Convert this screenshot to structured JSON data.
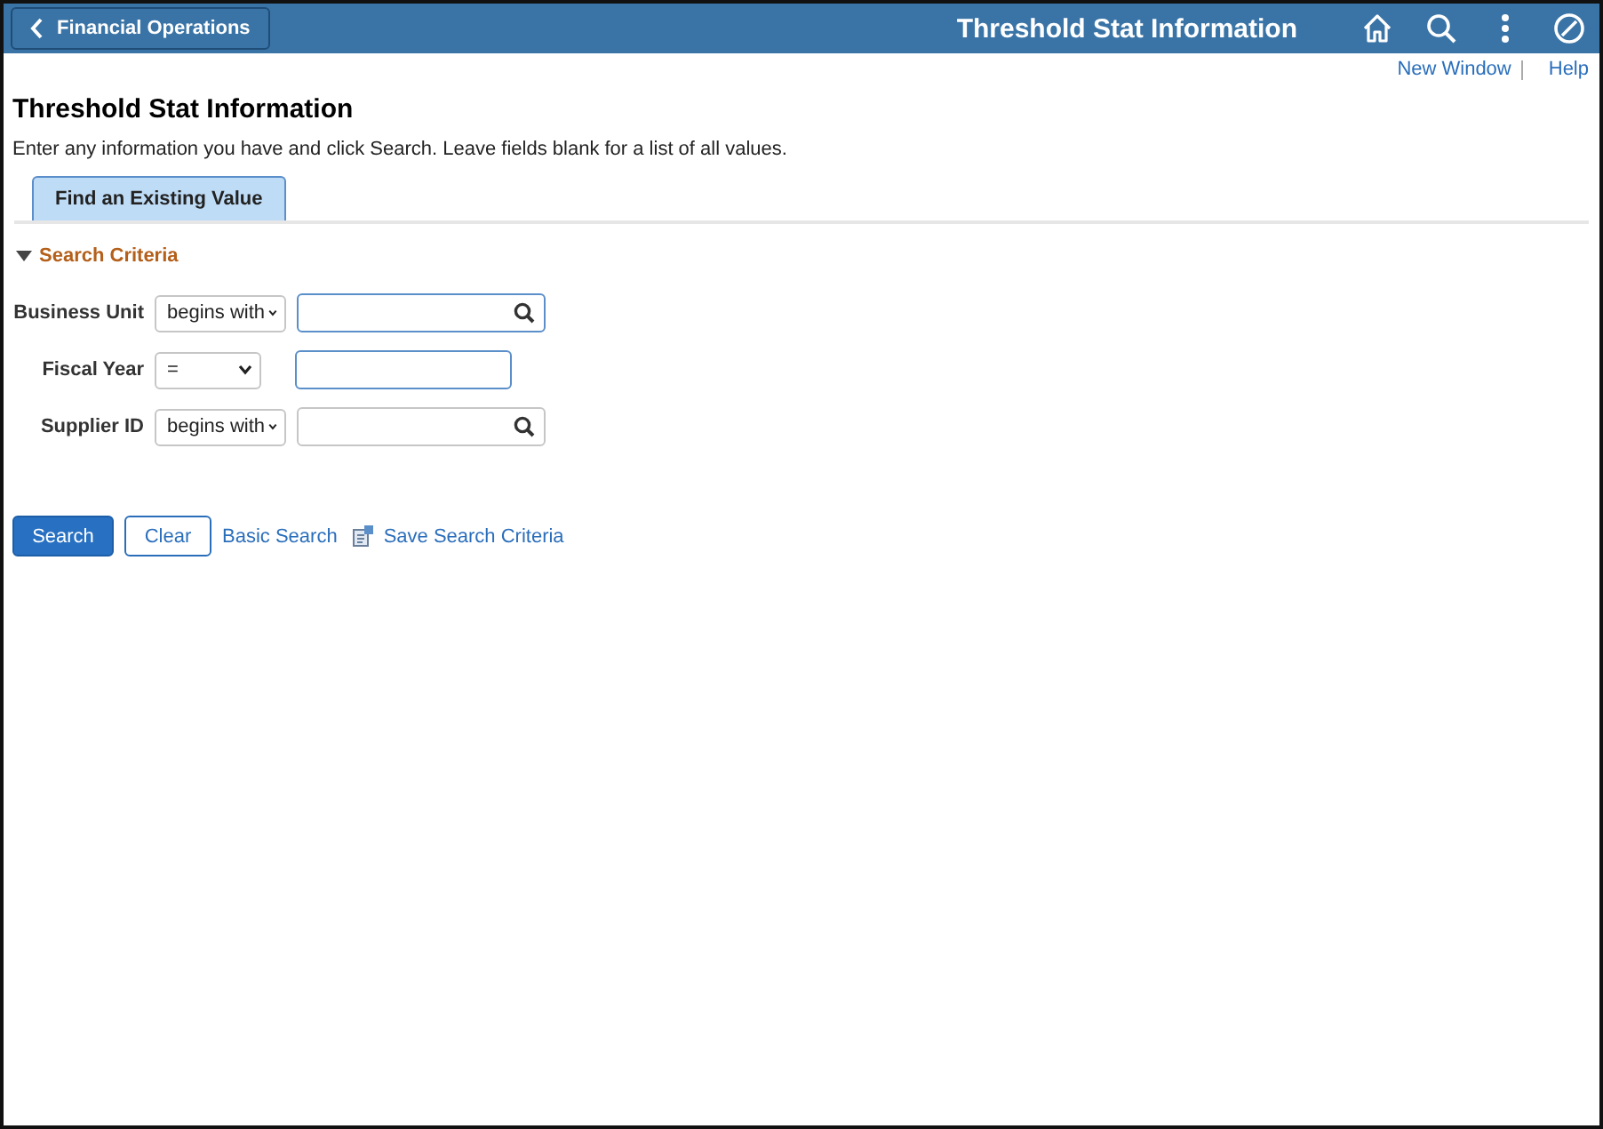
{
  "header": {
    "back_label": "Financial Operations",
    "title": "Threshold Stat Information"
  },
  "links": [
    "New Window",
    "Help"
  ],
  "page": {
    "title": "Threshold Stat Information",
    "instructions": "Enter any information you have and click Search. Leave fields blank for a list of all values."
  },
  "tabs": [
    {
      "label": "Find an Existing Value",
      "selected": true
    }
  ],
  "section": {
    "title": "Search Criteria",
    "expanded": true
  },
  "fields": [
    {
      "label": "Business Unit",
      "operator": "begins with",
      "required": true,
      "lookup": true
    },
    {
      "label": "Fiscal Year",
      "operator": "=",
      "required": true,
      "lookup": false
    },
    {
      "label": "Supplier ID",
      "operator": "begins with",
      "required": false,
      "lookup": true
    }
  ],
  "buttons": {
    "primary": "Search",
    "secondary": "Clear"
  },
  "actions": [
    "Basic Search",
    "Save Search Criteria"
  ]
}
